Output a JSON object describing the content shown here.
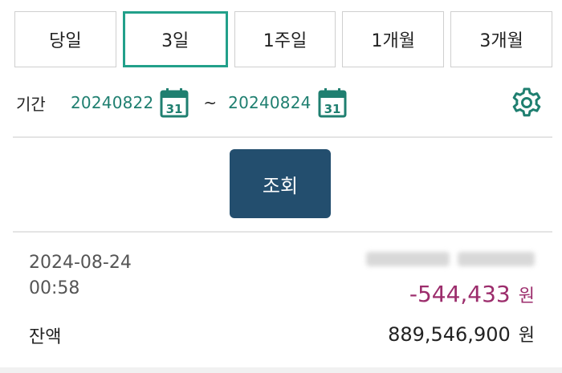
{
  "tabs": [
    {
      "label": "당일",
      "active": false
    },
    {
      "label": "3일",
      "active": true
    },
    {
      "label": "1주일",
      "active": false
    },
    {
      "label": "1개월",
      "active": false
    },
    {
      "label": "3개월",
      "active": false
    }
  ],
  "period": {
    "label": "기간",
    "start_date": "20240822",
    "separator": "~",
    "end_date": "20240824",
    "calendar_day": "31"
  },
  "search_button": {
    "label": "조회"
  },
  "transaction": {
    "date": "2024-08-24",
    "time": "00:58",
    "amount": "-544,433",
    "amount_unit": "원"
  },
  "balance": {
    "label": "잔액",
    "amount": "889,546,900",
    "unit": "원"
  },
  "colors": {
    "accent_teal": "#22a08a",
    "date_text": "#1f7f70",
    "button_bg": "#234e6e",
    "negative_amount": "#9c2d6c"
  },
  "icons": [
    "calendar-icon",
    "gear-icon"
  ]
}
